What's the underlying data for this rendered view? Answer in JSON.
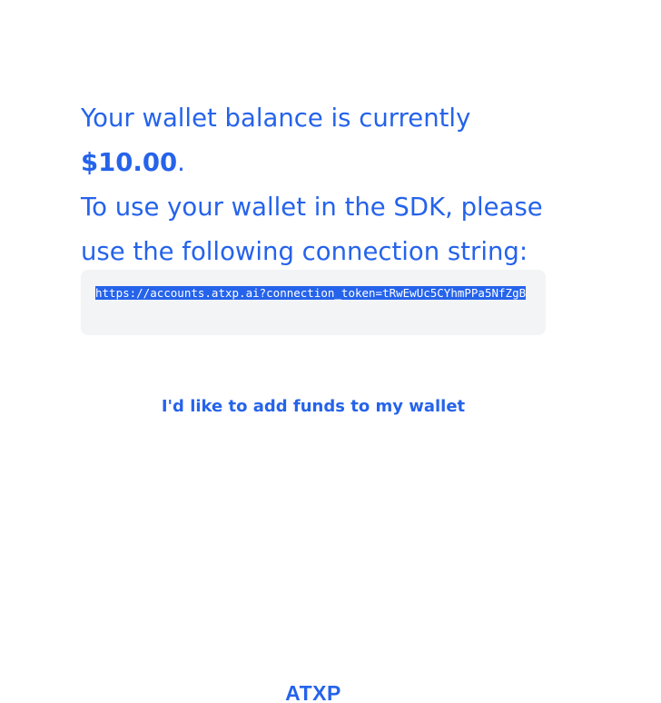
{
  "intro": {
    "line1_prefix": "Your wallet balance is currently ",
    "balance": "$10.00",
    "line1_suffix": ".",
    "line2": "To use your wallet in the SDK, please",
    "line3": "use the following connection string:"
  },
  "connection": {
    "string": "https://accounts.atxp.ai?connection_token=tRwEwUc5CYhmPPa5NfZgB"
  },
  "add_funds": {
    "label": "I'd like to add funds to my wallet"
  },
  "footer": {
    "logo_text": "ATXP"
  },
  "colors": {
    "accent": "#2563eb",
    "code_background": "#f3f4f6",
    "selection": "#2563eb"
  }
}
